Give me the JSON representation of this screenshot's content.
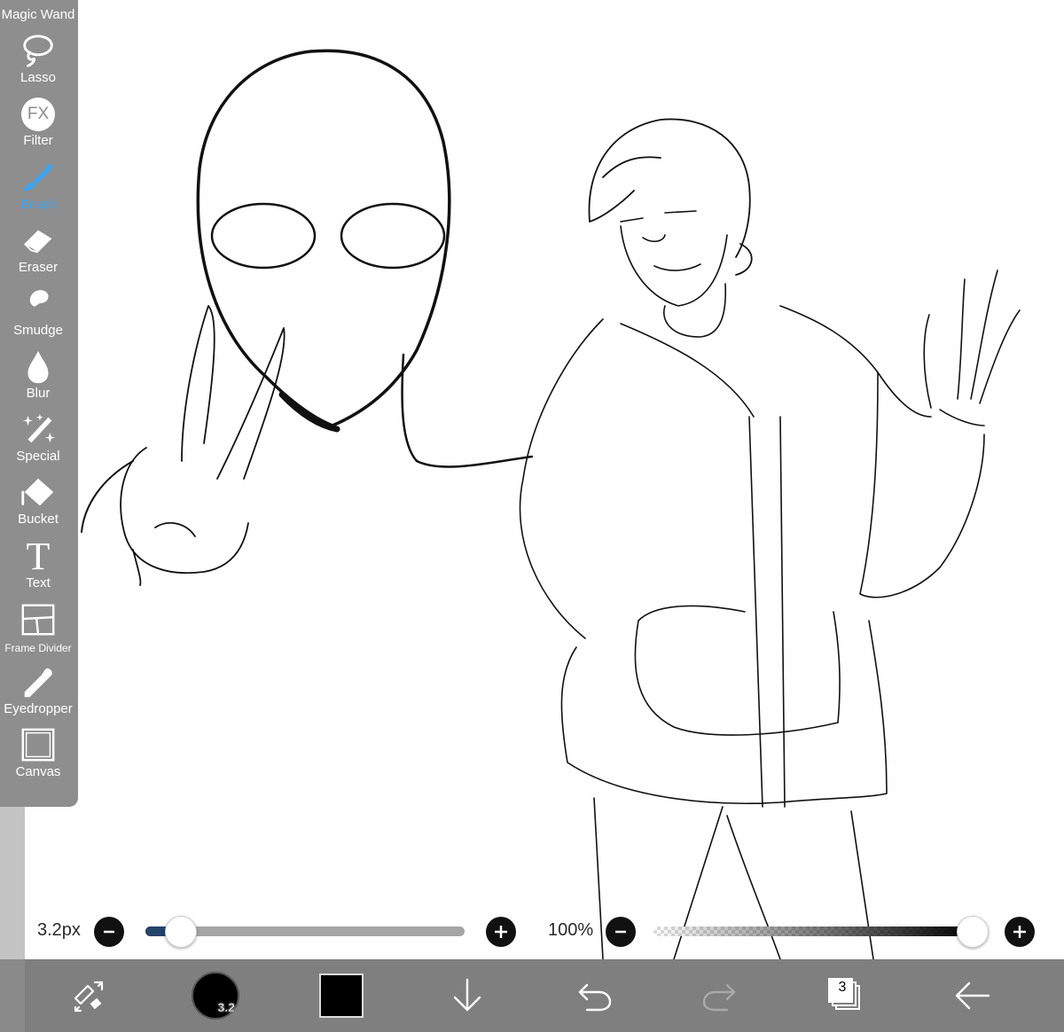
{
  "toolbar": {
    "tools": [
      {
        "label": "Magic Wand",
        "icon": "magic-wand-icon"
      },
      {
        "label": "Lasso",
        "icon": "lasso-icon"
      },
      {
        "label": "Filter",
        "icon": "fx-icon",
        "glyph": "FX"
      },
      {
        "label": "Brush",
        "icon": "brush-icon",
        "active": true
      },
      {
        "label": "Eraser",
        "icon": "eraser-icon"
      },
      {
        "label": "Smudge",
        "icon": "smudge-icon"
      },
      {
        "label": "Blur",
        "icon": "blur-drop-icon"
      },
      {
        "label": "Special",
        "icon": "special-sparkle-icon"
      },
      {
        "label": "Bucket",
        "icon": "bucket-icon"
      },
      {
        "label": "Text",
        "icon": "text-icon",
        "glyph": "T"
      },
      {
        "label": "Frame Divider",
        "icon": "frame-divider-icon"
      },
      {
        "label": "Eyedropper",
        "icon": "eyedropper-icon"
      },
      {
        "label": "Canvas",
        "icon": "canvas-icon"
      }
    ],
    "active_color": "#3fa4f0"
  },
  "brush_size": {
    "label": "3.2px",
    "value": 3.2,
    "fraction": 0.11
  },
  "opacity": {
    "label": "100%",
    "fraction": 1.0
  },
  "bottom_bar": {
    "brush_badge": "3.2",
    "layer_count": "3",
    "current_color": "#000000",
    "buttons": [
      "transform-tool-icon",
      "brush-size-badge",
      "color-swatch",
      "download-arrow-icon",
      "undo-icon",
      "redo-icon",
      "layers-icon",
      "back-arrow-icon"
    ]
  }
}
